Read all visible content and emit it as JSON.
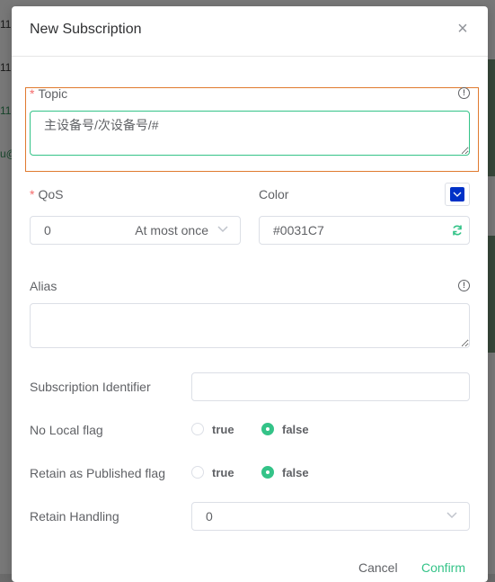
{
  "background": {
    "left_fragments": [
      "11",
      "11",
      "11",
      "u@"
    ],
    "left_colors": [
      "#333333",
      "#333333",
      "#2e8b57",
      "#2e8b57"
    ]
  },
  "dialog": {
    "title": "New Subscription",
    "close_label": "×"
  },
  "topic": {
    "required_mark": "*",
    "label": "Topic",
    "value": "主设备号/次设备号/#"
  },
  "qos": {
    "required_mark": "*",
    "label": "QoS",
    "value": "0",
    "description": "At most once"
  },
  "color": {
    "label": "Color",
    "value": "#0031C7",
    "swatch": "#0031C7"
  },
  "alias": {
    "label": "Alias",
    "value": ""
  },
  "subscription_identifier": {
    "label": "Subscription Identifier",
    "value": ""
  },
  "no_local": {
    "label": "No Local flag",
    "options": [
      "true",
      "false"
    ],
    "selected": "false"
  },
  "retain_as_published": {
    "label": "Retain as Published flag",
    "options": [
      "true",
      "false"
    ],
    "selected": "false"
  },
  "retain_handling": {
    "label": "Retain Handling",
    "value": "0"
  },
  "footer": {
    "cancel_label": "Cancel",
    "confirm_label": "Confirm"
  },
  "colors": {
    "accent": "#34c388",
    "required": "#f56c6c",
    "highlight_border": "#e07a2f"
  }
}
